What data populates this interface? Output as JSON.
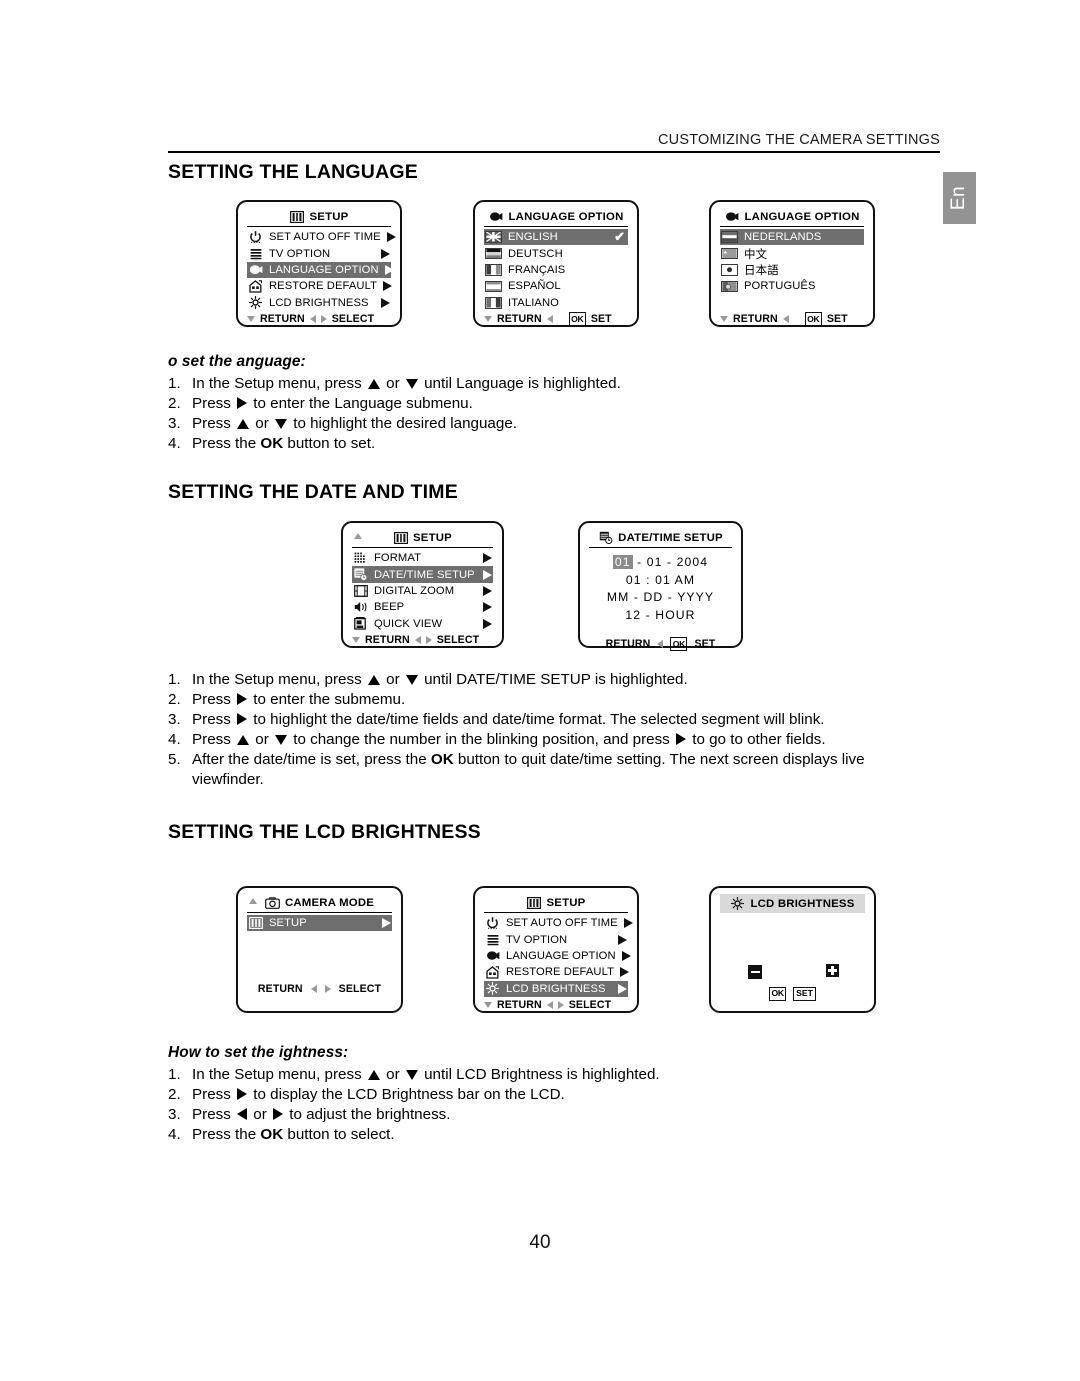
{
  "document": {
    "running_head": "CUSTOMIZING THE CAMERA SETTINGS",
    "language_tab": "En",
    "page_number": "40"
  },
  "sections": {
    "language": {
      "heading": "SETTING THE LANGUAGE",
      "screens": {
        "setup": {
          "title": "SETUP",
          "title_icon": "setup-icon",
          "rows": [
            {
              "label": "SET AUTO OFF TIME",
              "icon": "power-clock-icon",
              "selected": false
            },
            {
              "label": "TV OPTION",
              "icon": "tv-lines-icon",
              "selected": false
            },
            {
              "label": "LANGUAGE OPTION",
              "icon": "speech-globe-icon",
              "selected": true
            },
            {
              "label": "RESTORE DEFAULT",
              "icon": "restore-house-icon",
              "selected": false
            },
            {
              "label": "LCD BRIGHTNESS",
              "icon": "sun-icon",
              "selected": false
            }
          ],
          "footer": {
            "return": "RETURN",
            "select": "SELECT"
          }
        },
        "language_page1": {
          "title": "LANGUAGE  OPTION",
          "title_icon": "speech-globe-icon",
          "rows": [
            {
              "label": "ENGLISH",
              "flag": "flag-uk",
              "selected": true,
              "check": "✔"
            },
            {
              "label": "DEUTSCH",
              "flag": "flag-de",
              "selected": false
            },
            {
              "label": "FRANÇAIS",
              "flag": "flag-fr",
              "selected": false
            },
            {
              "label": "ESPAÑOL",
              "flag": "flag-es",
              "selected": false
            },
            {
              "label": "ITALIANO",
              "flag": "flag-it",
              "selected": false
            }
          ],
          "footer": {
            "return": "RETURN",
            "ok": "OK",
            "set": "SET"
          }
        },
        "language_page2": {
          "title": "LANGUAGE  OPTION",
          "title_icon": "speech-globe-icon",
          "rows": [
            {
              "label": "NEDERLANDS",
              "flag": "flag-nl",
              "selected": true
            },
            {
              "label": "中文",
              "flag": "flag-cn",
              "selected": false
            },
            {
              "label": "日本語",
              "flag": "flag-jp",
              "selected": false
            },
            {
              "label": "PORTUGUÊS",
              "flag": "flag-pt",
              "selected": false
            }
          ],
          "footer": {
            "return": "RETURN",
            "ok": "OK",
            "set": "SET"
          }
        }
      },
      "howto": {
        "subhead": "o  set the  anguage:",
        "steps": [
          {
            "num": "1.",
            "pre": "In the Setup menu, press ",
            "glyphs": [
              "up",
              "down"
            ],
            "mid": " or ",
            "post": " until Language is highlighted."
          },
          {
            "num": "2.",
            "pre": "Press ",
            "glyphs": [
              "right"
            ],
            "post": " to enter the Language submenu."
          },
          {
            "num": "3.",
            "pre": "Press ",
            "glyphs": [
              "up",
              "down"
            ],
            "mid": " or ",
            "post": " to highlight the desired language."
          },
          {
            "num": "4.",
            "pre": "Press the ",
            "bold": "OK",
            "post": " button to set."
          }
        ]
      }
    },
    "datetime": {
      "heading": "SETTING THE DATE AND TIME",
      "screens": {
        "setup": {
          "title": "SETUP",
          "title_icon": "setup-icon",
          "rows": [
            {
              "label": "FORMAT",
              "icon": "format-grid-icon",
              "selected": false
            },
            {
              "label": "DATE/TIME SETUP",
              "icon": "calendar-clock-icon",
              "selected": true
            },
            {
              "label": "DIGITAL ZOOM",
              "icon": "zoom-frame-icon",
              "selected": false
            },
            {
              "label": "BEEP",
              "icon": "speaker-icon",
              "selected": false
            },
            {
              "label": "QUICK VIEW",
              "icon": "quick-view-icon",
              "selected": false
            }
          ],
          "footer": {
            "return": "RETURN",
            "select": "SELECT"
          }
        },
        "datetime_setup": {
          "title": "DATE/TIME SETUP",
          "title_icon": "calendar-clock-icon",
          "lines": [
            {
              "highlight": "01",
              "rest": " - 01 - 2004"
            },
            {
              "text": "01 : 01 AM"
            },
            {
              "text": "MM - DD - YYYY"
            },
            {
              "text": "12 - HOUR"
            }
          ],
          "footer": {
            "return": "RETURN",
            "ok": "OK",
            "set": "SET"
          }
        }
      },
      "howto": {
        "steps": [
          {
            "num": "1.",
            "pre": "In the Setup menu, press ",
            "glyphs": [
              "up",
              "down"
            ],
            "mid": " or ",
            "post": " until DATE/TIME SETUP is highlighted."
          },
          {
            "num": "2.",
            "pre": "Press ",
            "glyphs": [
              "right"
            ],
            "post": " to enter the submemu."
          },
          {
            "num": "3.",
            "pre": "Press ",
            "glyphs": [
              "right"
            ],
            "post": " to highlight the date/time fields and date/time format. The selected segment will blink."
          },
          {
            "num": "4.",
            "pre": "Press ",
            "glyphs": [
              "up",
              "down"
            ],
            "mid": " or ",
            "post": " to change the number in the blinking position, and press ",
            "glyphs2": [
              "right"
            ],
            "post2": " to go to other fields."
          },
          {
            "num": "5.",
            "pre": "After the date/time is set, press the ",
            "bold": "OK",
            "post": " button to quit date/time setting. The next screen displays live viewfinder."
          }
        ]
      }
    },
    "brightness": {
      "heading": "SETTING THE LCD BRIGHTNESS",
      "screens": {
        "camera_mode": {
          "title": "CAMERA MODE",
          "title_icon": "camera-icon",
          "rows": [
            {
              "label": "SETUP",
              "icon": "setup-icon",
              "selected": true
            }
          ],
          "footer": {
            "return": "RETURN",
            "select": "SELECT"
          }
        },
        "setup": {
          "title": "SETUP",
          "title_icon": "setup-icon",
          "rows": [
            {
              "label": "SET AUTO OFF TIME",
              "icon": "power-clock-icon",
              "selected": false
            },
            {
              "label": "TV OPTION",
              "icon": "tv-lines-icon",
              "selected": false
            },
            {
              "label": "LANGUAGE OPTION",
              "icon": "speech-globe-icon",
              "selected": false
            },
            {
              "label": "RESTORE DEFAULT",
              "icon": "restore-house-icon",
              "selected": false
            },
            {
              "label": "LCD BRIGHTNESS",
              "icon": "sun-icon",
              "selected": true
            }
          ],
          "footer": {
            "return": "RETURN",
            "select": "SELECT"
          }
        },
        "lcd_brightness": {
          "title": "LCD BRIGHTNESS",
          "title_icon": "sun-icon",
          "minus_label": "-",
          "plus_label": "+",
          "footer": {
            "ok": "OK",
            "set": "SET"
          }
        }
      },
      "howto": {
        "subhead": "How to set the  ightness:",
        "steps": [
          {
            "num": "1.",
            "pre": "In the Setup menu, press ",
            "glyphs": [
              "up",
              "down"
            ],
            "mid": " or ",
            "post": " until LCD Brightness is highlighted."
          },
          {
            "num": "2.",
            "pre": "Press ",
            "glyphs": [
              "right"
            ],
            "post": " to display the LCD Brightness bar on the LCD."
          },
          {
            "num": "3.",
            "pre": "Press ",
            "glyphs": [
              "left",
              "right"
            ],
            "mid": " or ",
            "post": " to adjust the brightness."
          },
          {
            "num": "4.",
            "pre": "Press the ",
            "bold": "OK",
            "post": " button to select."
          }
        ]
      }
    }
  },
  "colors": {
    "selection_bar": "#6e6e6e",
    "tab_background": "#939393",
    "title_box": "#d9d9d9"
  }
}
